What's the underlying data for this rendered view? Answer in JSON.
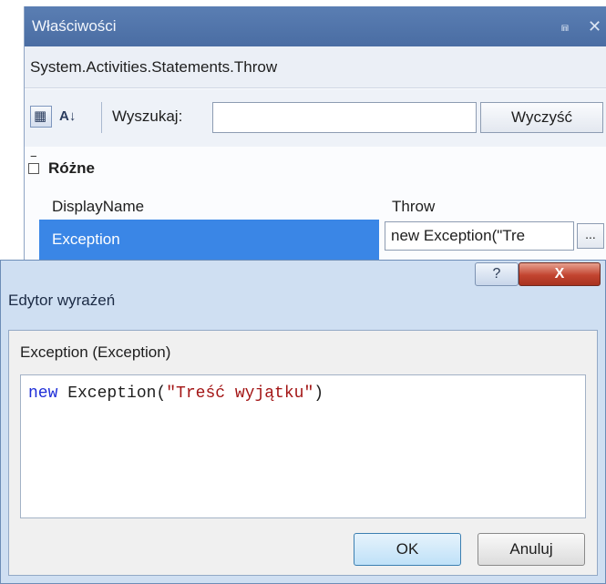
{
  "properties_panel": {
    "title": "Właściwości",
    "pin_icon": "⩎",
    "close_icon": "✕",
    "type_name": "System.Activities.Statements.Throw",
    "toolbar": {
      "categorized_icon": "▦",
      "sort_icon": "A↓",
      "search_label": "Wyszukaj:",
      "search_value": "",
      "clear_label": "Wyczyść"
    },
    "category": {
      "expander": "−",
      "label": "Różne"
    },
    "rows": [
      {
        "name": "DisplayName",
        "value": "Throw"
      },
      {
        "name": "Exception",
        "value": "new Exception(\"Tre",
        "selected": true
      }
    ],
    "ellipsis_label": "..."
  },
  "dialog": {
    "title": "Edytor wyrażeń",
    "help_icon": "?",
    "close_icon": "X",
    "field_label": "Exception (Exception)",
    "expression": {
      "keyword": "new",
      "type": " Exception(",
      "string_literal": "\"Treść wyjątku\"",
      "close": ")"
    },
    "ok_label": "OK",
    "cancel_label": "Anuluj"
  },
  "colors": {
    "title_bar": "#4a6da3",
    "selection": "#3a86e6",
    "keyword": "#1f2fd8",
    "string": "#a31515",
    "close_button": "#c24430"
  }
}
